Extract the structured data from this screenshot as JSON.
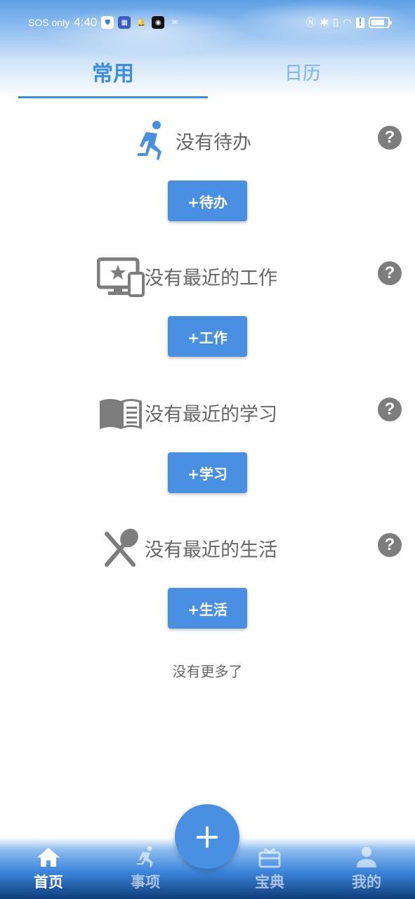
{
  "status_bar": {
    "sos": "SOS only",
    "time": "4:40",
    "battery_level": 0.8
  },
  "tabs": [
    {
      "label": "常用",
      "active": true
    },
    {
      "label": "日历",
      "active": false
    }
  ],
  "sections": [
    {
      "icon": "running-person-icon",
      "title": "没有待办",
      "button": "+待办",
      "help": "?"
    },
    {
      "icon": "monitor-phone-icon",
      "title": "没有最近的工作",
      "button": "+工作",
      "help": "?"
    },
    {
      "icon": "book-icon",
      "title": "没有最近的学习",
      "button": "+学习",
      "help": "?"
    },
    {
      "icon": "spoon-knife-icon",
      "title": "没有最近的生活",
      "button": "+生活",
      "help": "?"
    }
  ],
  "no_more_text": "没有更多了",
  "fab_label": "+",
  "bottom_nav": [
    {
      "label": "首页",
      "icon": "home-icon",
      "active": true
    },
    {
      "label": "事项",
      "icon": "running-person-icon",
      "active": false
    },
    {
      "label": "宝典",
      "icon": "gift-box-icon",
      "active": false
    },
    {
      "label": "我的",
      "icon": "person-icon",
      "active": false
    }
  ],
  "colors": {
    "accent": "#4a90e2",
    "tab_active": "#3f8de3",
    "tab_inactive": "#7fb3ee",
    "text_gray": "#666666",
    "icon_gray": "#7d7d7d"
  }
}
